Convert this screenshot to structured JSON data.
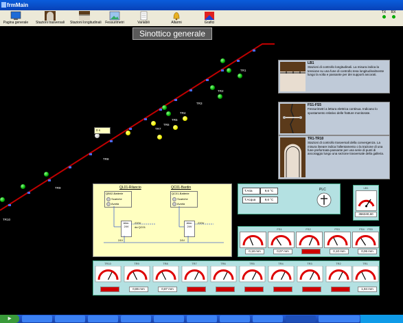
{
  "window": {
    "title": "frmMain"
  },
  "toolbar": {
    "buttons": [
      {
        "label": "Pagina generale",
        "icon": "monitor-icon"
      },
      {
        "label": "Stazioni trasversali",
        "icon": "tunnel-section-icon"
      },
      {
        "label": "Stazioni longitudinali",
        "icon": "tunnel-long-icon"
      },
      {
        "label": "Fessurimetri",
        "icon": "picture-icon"
      },
      {
        "label": "Variabili",
        "icon": "notepad-icon"
      },
      {
        "label": "Allarmi",
        "icon": "bell-icon"
      },
      {
        "label": "Grafici",
        "icon": "chart-icon"
      }
    ],
    "tx": "TX",
    "rx": "RX"
  },
  "page": {
    "heading": "Sinottico generale"
  },
  "map": {
    "counter_value": "0 s",
    "tr_labels": [
      "TR1",
      "TR2",
      "TR3",
      "TR4",
      "TR5",
      "TR6",
      "TR7",
      "TR8",
      "TR9",
      "TR10"
    ]
  },
  "legend": [
    {
      "title": "LB1",
      "text": "Stazioni di controllo longitudinali. La misura indica la tensione su una fune di controllo tesa longitudinalmente lungo la volta e passante per dei supporti ancorati."
    },
    {
      "title": "FS1-FS5",
      "text": "Fessurimetri a lettura elettrica continua. Indicano lo spostamento relativo delle fratture monitorate."
    },
    {
      "title": "TR1-TR10",
      "text": "Stazioni di controllo trasversali della convergenza. La misura lineare indica l'allentamento o la trazione di una fune preformata passante per una serie di punti di ancoraggio lungo una sezione trasversale della galleria."
    }
  ],
  "power": {
    "left": {
      "title": "QL01-Rilancio",
      "battery": "QB02-Batterie",
      "charge": "Scariche",
      "fault": "Avaria",
      "supply": "Alim. 24V",
      "v220": "220V",
      "from": "da QC01",
      "v24": "24V"
    },
    "right": {
      "title": "QC01-Bardin",
      "battery": "QC01-Batterie",
      "charge": "Scariche",
      "fault": "Avaria",
      "supply": "Alim. 24V",
      "v220": "220V",
      "v24": "24V"
    }
  },
  "temps": {
    "air_label": "T.Aria",
    "air_value": "9,6 °C",
    "water_label": "T.Acqua",
    "water_value": "9,6 °C",
    "plc": "PLC"
  },
  "lb1": {
    "label": "LB1",
    "value": "366340,60"
  },
  "fs": {
    "labels": [
      "FS1",
      "FS2",
      "FS3",
      "FS4",
      "FS5"
    ],
    "values": [
      "0,18 mm",
      "0,07 mm",
      "",
      "0,10 mm",
      "0,06 mm"
    ]
  },
  "tr": {
    "labels": [
      "TR10",
      "TR9",
      "TR8",
      "TR7",
      "TR6",
      "TR5",
      "TR4",
      "TR3",
      "TR2",
      "TR1"
    ],
    "values": [
      "",
      "0,86 mm",
      "0,87 mm",
      "",
      "",
      "",
      "",
      "",
      "",
      "1,94 mm"
    ]
  },
  "colors": {
    "accent": "#d00000",
    "line": "#c00000",
    "panel": "#b4e1e2",
    "yellow_panel": "#ffffc0"
  }
}
